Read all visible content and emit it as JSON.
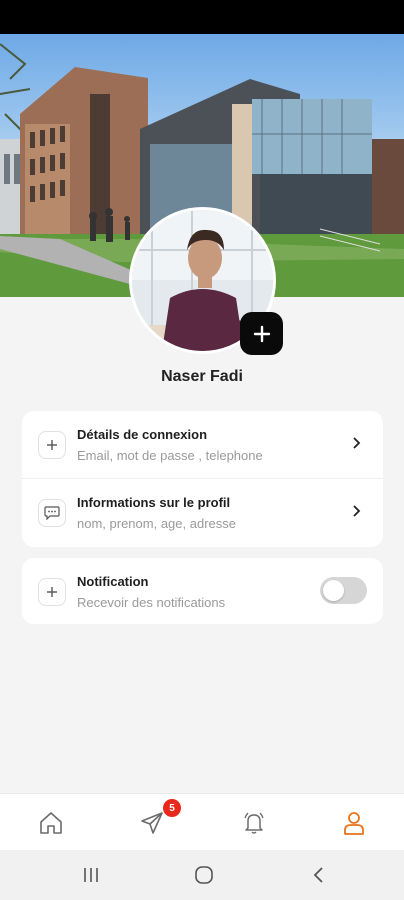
{
  "user": {
    "name": "Naser Fadi"
  },
  "settings": {
    "items": [
      {
        "title": "Détails de connexion",
        "subtitle": "Email, mot de passe , telephone",
        "icon": "plus-icon"
      },
      {
        "title": "Informations sur le profil",
        "subtitle": "nom, prenom, age, adresse",
        "icon": "message-icon"
      }
    ]
  },
  "notification": {
    "title": "Notification",
    "subtitle": "Recevoir des notifications",
    "enabled": false
  },
  "bottom_nav": {
    "items": [
      "home-icon",
      "send-icon",
      "bell-icon",
      "profile-icon"
    ],
    "active": "profile",
    "messages_badge": "5"
  },
  "colors": {
    "accent": "#e8741c",
    "badge": "#e8281c",
    "avatar_button": "#0a0a0a"
  }
}
